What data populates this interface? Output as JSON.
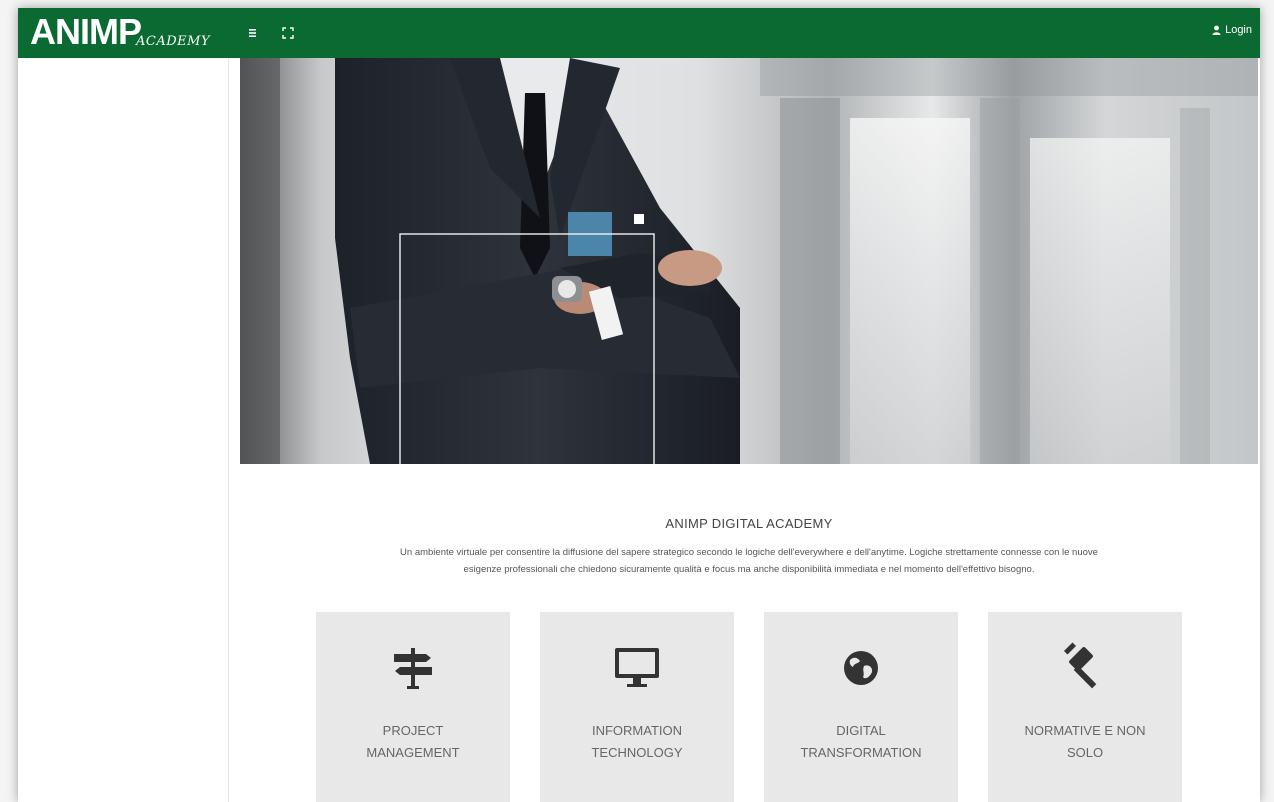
{
  "header": {
    "logo_main": "ANIMP",
    "logo_sub": "ACADEMY",
    "login_label": "Login",
    "menu_toggle_icon": "bars-icon",
    "fullscreen_icon": "expand-icon",
    "user_icon": "user-icon"
  },
  "colors": {
    "brand_green": "#0b6a32",
    "card_bg": "#e8e8e8",
    "icon_color": "#333333",
    "hero_accent": "#4e8db4"
  },
  "main": {
    "title": "ANIMP DIGITAL ACADEMY",
    "description_line1": "Un ambiente virtuale per consentire la diffusione del sapere strategico secondo le logiche dell'everywhere e dell'anytime. Logiche strettamente connesse con le nuove",
    "description_line2": "esigenze professionali che chiedono sicuramente qualità e focus ma anche disponibilità immediata e nel momento dell'effettivo bisogno.",
    "cards": [
      {
        "label": "PROJECT\nMANAGEMENT",
        "icon": "signpost-icon"
      },
      {
        "label": "INFORMATION\nTECHNOLOGY",
        "icon": "monitor-icon"
      },
      {
        "label": "DIGITAL\nTRANSFORMATION",
        "icon": "globe-icon"
      },
      {
        "label": "NORMATIVE E NON\nSOLO",
        "icon": "gavel-icon"
      }
    ]
  }
}
